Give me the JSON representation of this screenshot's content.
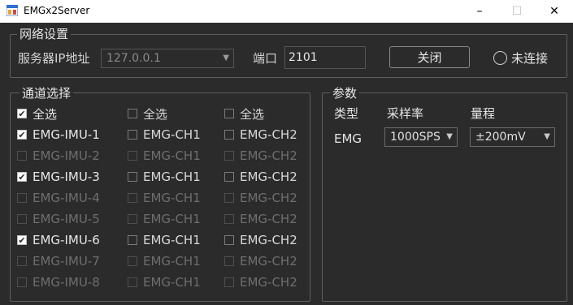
{
  "window": {
    "title": "EMGx2Server",
    "minimize": "–",
    "maximize": "☐",
    "close": "✕"
  },
  "network": {
    "legend": "网络设置",
    "ip_label": "服务器IP地址",
    "ip_value": "127.0.0.1",
    "port_label": "端口",
    "port_value": "2101",
    "close_button": "关闭",
    "status": "未连接"
  },
  "channels": {
    "legend": "通道选择",
    "rows": [
      {
        "imu": {
          "label": "全选",
          "state": "on"
        },
        "ch1": {
          "label": "全选",
          "state": "plain"
        },
        "ch2": {
          "label": "全选",
          "state": "plain"
        }
      },
      {
        "imu": {
          "label": "EMG-IMU-1",
          "state": "on"
        },
        "ch1": {
          "label": "EMG-CH1",
          "state": "plain"
        },
        "ch2": {
          "label": "EMG-CH2",
          "state": "plain"
        }
      },
      {
        "imu": {
          "label": "EMG-IMU-2",
          "state": "off"
        },
        "ch1": {
          "label": "EMG-CH1",
          "state": "off"
        },
        "ch2": {
          "label": "EMG-CH2",
          "state": "off"
        }
      },
      {
        "imu": {
          "label": "EMG-IMU-3",
          "state": "on"
        },
        "ch1": {
          "label": "EMG-CH1",
          "state": "plain"
        },
        "ch2": {
          "label": "EMG-CH2",
          "state": "plain"
        }
      },
      {
        "imu": {
          "label": "EMG-IMU-4",
          "state": "off"
        },
        "ch1": {
          "label": "EMG-CH1",
          "state": "off"
        },
        "ch2": {
          "label": "EMG-CH2",
          "state": "off"
        }
      },
      {
        "imu": {
          "label": "EMG-IMU-5",
          "state": "off"
        },
        "ch1": {
          "label": "EMG-CH1",
          "state": "off"
        },
        "ch2": {
          "label": "EMG-CH2",
          "state": "off"
        }
      },
      {
        "imu": {
          "label": "EMG-IMU-6",
          "state": "on"
        },
        "ch1": {
          "label": "EMG-CH1",
          "state": "plain"
        },
        "ch2": {
          "label": "EMG-CH2",
          "state": "plain"
        }
      },
      {
        "imu": {
          "label": "EMG-IMU-7",
          "state": "off"
        },
        "ch1": {
          "label": "EMG-CH1",
          "state": "off"
        },
        "ch2": {
          "label": "EMG-CH2",
          "state": "off"
        }
      },
      {
        "imu": {
          "label": "EMG-IMU-8",
          "state": "off"
        },
        "ch1": {
          "label": "EMG-CH1",
          "state": "off"
        },
        "ch2": {
          "label": "EMG-CH2",
          "state": "off"
        }
      }
    ]
  },
  "params": {
    "legend": "参数",
    "headers": {
      "type": "类型",
      "rate": "采样率",
      "range": "量程"
    },
    "row": {
      "type": "EMG",
      "rate": "1000SPS",
      "range": "±200mV"
    }
  },
  "colors": {
    "background": "#2b2b2b",
    "border": "#5f5f5f",
    "text": "#e6e6e6",
    "disabled_text": "#6e6e6e"
  }
}
